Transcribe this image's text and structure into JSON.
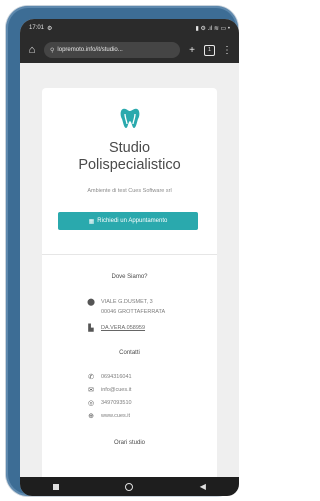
{
  "status_bar": {
    "time": "17:01",
    "left_icon": "settings-gear-icon",
    "right_text": "▮ ⚙ .ıl ≋ ▭ •"
  },
  "browser": {
    "url": "lopremoto.info/it/studio...",
    "tab_count": "1"
  },
  "page": {
    "title_line1": "Studio",
    "title_line2": "Polispecialistico",
    "subtitle": "Ambiente di test Cues Software srl",
    "cta_label": "Richiedi un Appuntamento",
    "where_heading": "Dove Siamo?",
    "address_line1": "VIALE G.DUSMET, 3",
    "address_line2": "00046 GROTTAFERRATA",
    "vat": "DA.VERA.058959",
    "contacts_heading": "Contatti",
    "phone": "0694316041",
    "email": "info@cues.it",
    "whatsapp": "3497093510",
    "website": "www.cues.it",
    "hours_heading": "Orari studio"
  },
  "colors": {
    "accent": "#2aa9ad",
    "phone_frame": "#3d6d95",
    "topbar": "#2b2b2b"
  }
}
